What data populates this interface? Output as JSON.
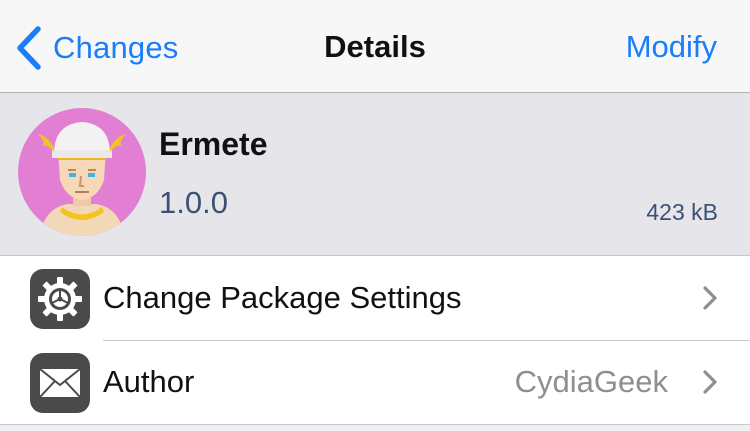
{
  "navbar": {
    "back_label": "Changes",
    "title": "Details",
    "action_label": "Modify"
  },
  "package": {
    "name": "Ermete",
    "version": "1.0.0",
    "size": "423 kB",
    "icon": "hermes-avatar"
  },
  "rows": [
    {
      "label": "Change Package Settings",
      "value": "",
      "icon": "gear-icon"
    },
    {
      "label": "Author",
      "value": "CydiaGeek",
      "icon": "envelope-icon"
    }
  ],
  "colors": {
    "accent": "#1a7ef8",
    "header_bg": "#e5e5ea",
    "meta_text": "#3c5275",
    "secondary_text": "#8e8e93",
    "icon_tile": "#4a4a4a"
  }
}
